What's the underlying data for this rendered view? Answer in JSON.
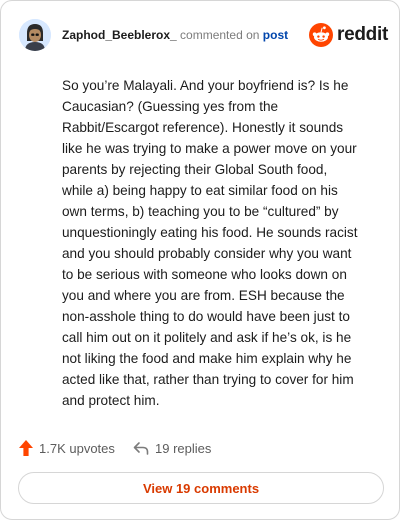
{
  "header": {
    "username": "Zaphod_Beeblerox_",
    "commented_text": "commented on",
    "post_link": "post",
    "brand": "reddit"
  },
  "comment": {
    "text": "So you’re Malayali. And your boyfriend is? Is he\nCaucasian? (Guessing yes from the\nRabbit/Escargot reference). Honestly it sounds\nlike he was trying to make a power move on your\nparents by rejecting their Global South food,\nwhile a) being happy to eat similar food on his\nown terms, b) teaching you to be “cultured” by\nunquestioningly eating his food. He sounds racist\nand you should probably consider why you want\nto be serious with someone who looks down on\nyou and where you are from. ESH because the\nnon-asshole thing to do would have been just to\ncall him out on it politely and ask if he’s ok, is he\nnot liking the food and make him explain why he\nacted like that, rather than trying to cover for him\nand protect him."
  },
  "actions": {
    "upvotes": "1.7K upvotes",
    "replies": "19 replies"
  },
  "view_button": "View 19 comments",
  "colors": {
    "upvote": "#ff4500",
    "link": "#0045ac",
    "view_button_text": "#d93a00",
    "border": "#d6d6d6"
  }
}
